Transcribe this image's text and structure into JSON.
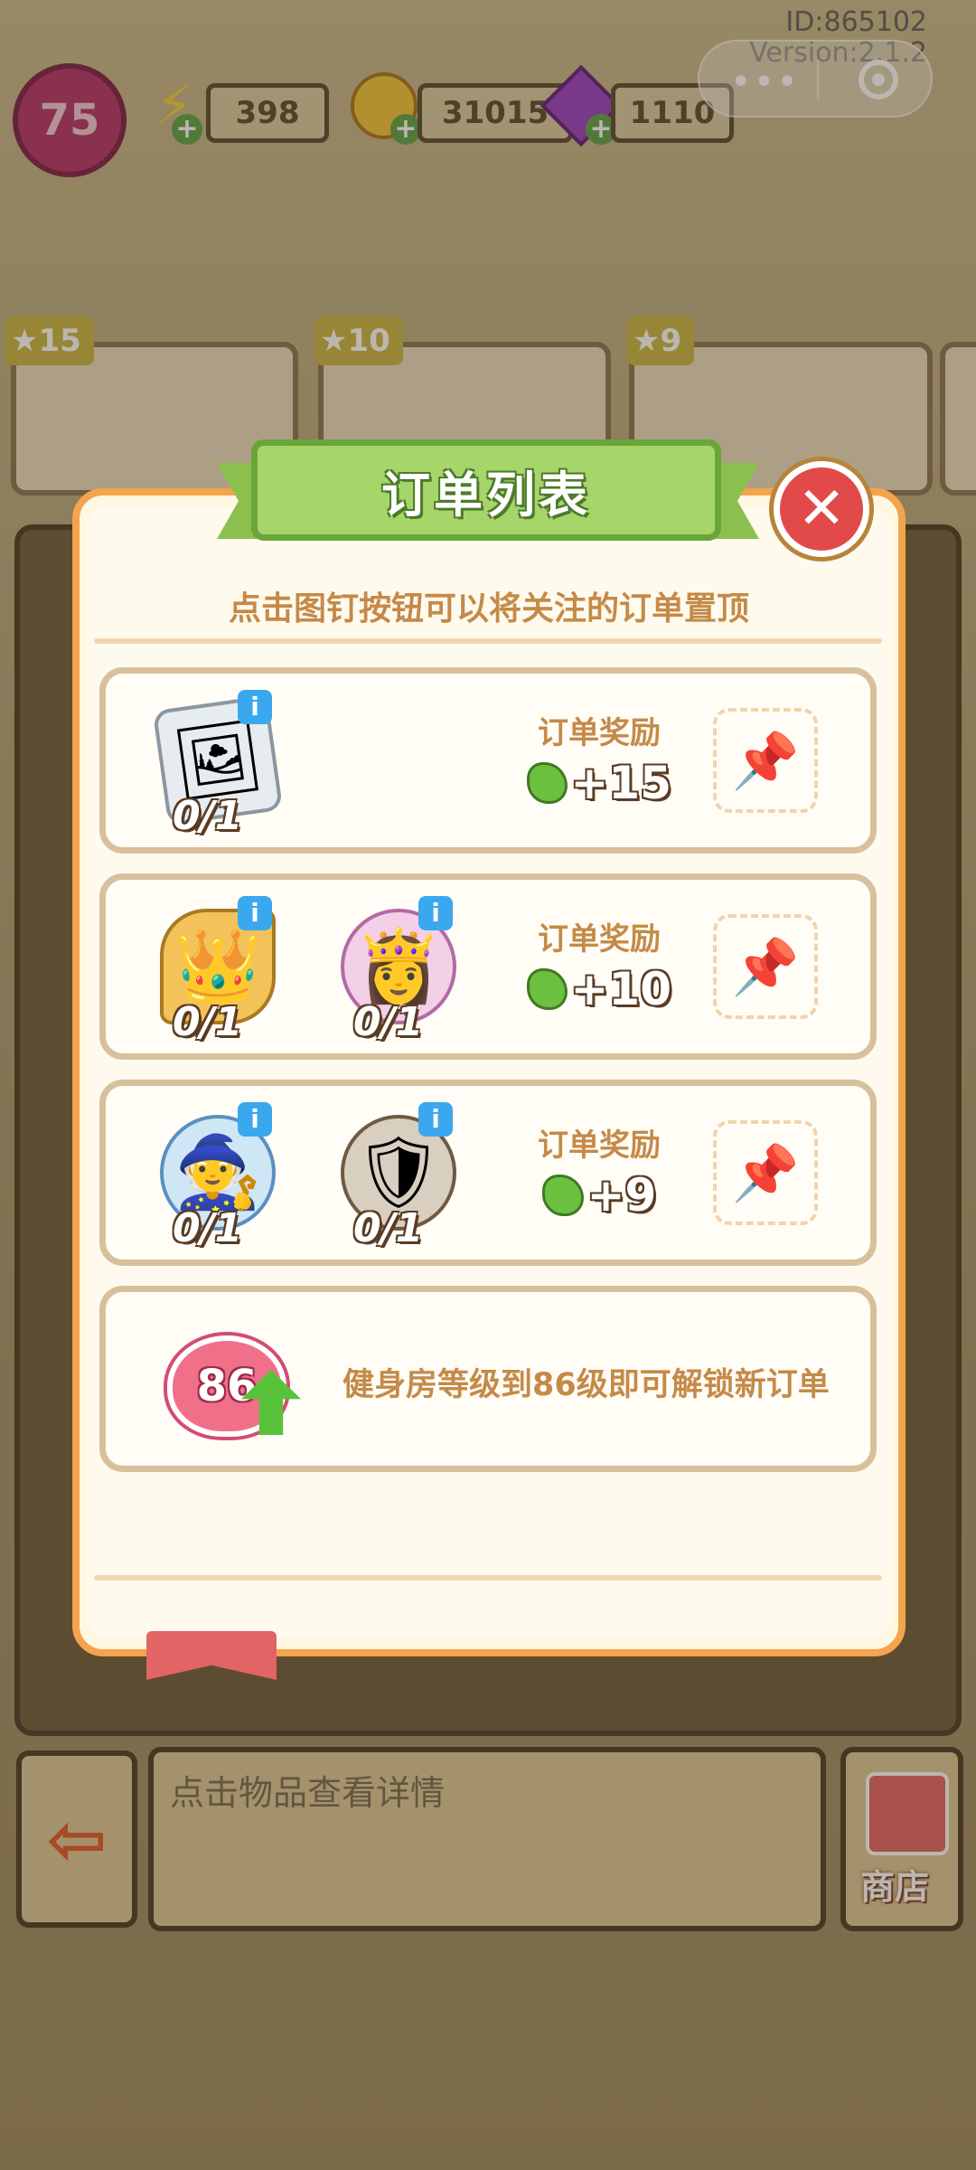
{
  "header": {
    "player_level": "75",
    "energy": "398",
    "coins": "31015",
    "gems": "1110",
    "id_label": "ID:865102",
    "version_label": "Version:2.1.2"
  },
  "background_orders": [
    {
      "stars": "15"
    },
    {
      "stars": "10"
    },
    {
      "stars": "9"
    }
  ],
  "dialog": {
    "title": "订单列表",
    "hint": "点击图钉按钮可以将关注的订单置顶",
    "orders": [
      {
        "items": [
          {
            "icon": "photo-cards-icon",
            "count": "0/1"
          }
        ],
        "reward_label": "订单奖励",
        "reward": "+15"
      },
      {
        "items": [
          {
            "icon": "crown-icon",
            "count": "0/1"
          },
          {
            "icon": "princess-character-icon",
            "count": "0/1"
          }
        ],
        "reward_label": "订单奖励",
        "reward": "+10"
      },
      {
        "items": [
          {
            "icon": "wizard-character-icon",
            "count": "0/1"
          },
          {
            "icon": "warrior-character-icon",
            "count": "0/1"
          }
        ],
        "reward_label": "订单奖励",
        "reward": "+9"
      }
    ],
    "locked": {
      "level": "86",
      "text": "健身房等级到86级即可解锁新订单"
    }
  },
  "bottom": {
    "info_placeholder": "点击物品查看详情",
    "shop_label": "商店"
  },
  "colors": {
    "accent_green": "#a6d66a",
    "text_orange": "#c58a48",
    "close_red": "#e24a4a",
    "dialog_border": "#f3a44d"
  }
}
